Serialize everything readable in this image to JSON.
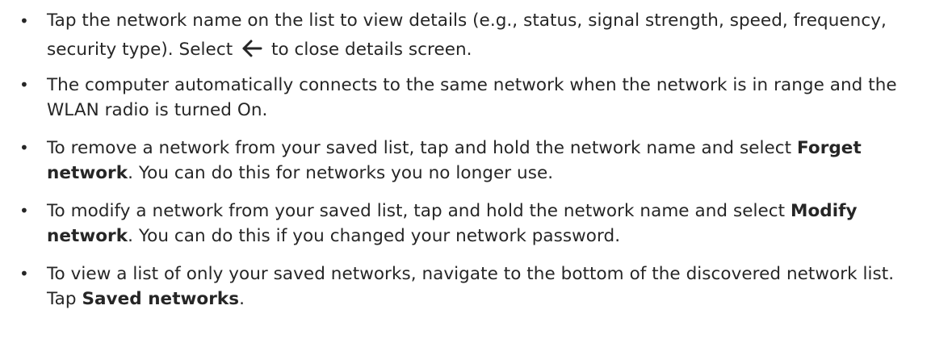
{
  "bullet_symbol": "•",
  "items": [
    {
      "pre": "Tap the network name on the list to view details (e.g., status, signal strength, speed, frequency, security type). Select ",
      "icon": "back-arrow-icon",
      "post": " to close details screen."
    },
    {
      "text": "The computer automatically connects to the same network when the network is in range and the WLAN radio is turned On."
    },
    {
      "pre": "To remove a network from your saved list, tap and hold the network name and select ",
      "bold": "Forget network",
      "post": ". You can do this for networks you no longer use."
    },
    {
      "pre": "To modify a network from your saved list, tap and hold the network name and select ",
      "bold": "Modify network",
      "post": ". You can do this if you changed your network password."
    },
    {
      "pre": "To view a list of only your saved networks, navigate to the bottom of the discovered network list. Tap ",
      "bold": "Saved networks",
      "post": "."
    }
  ]
}
